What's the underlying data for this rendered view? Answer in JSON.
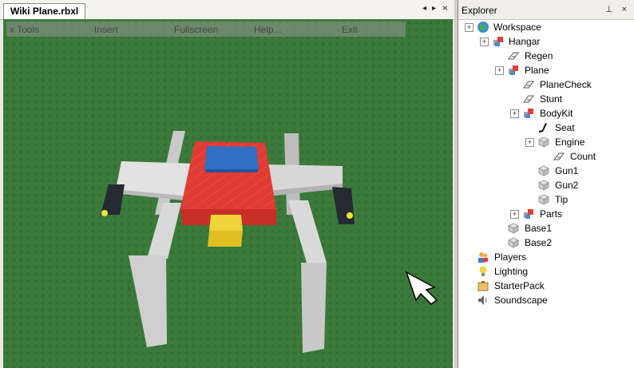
{
  "document": {
    "tab_title": "Wiki Plane.rbxl",
    "pane_controls": [
      "◂",
      "▸",
      "×"
    ]
  },
  "menu": {
    "items": [
      "x Tools",
      "Insert",
      "Fullscreen",
      "Help...",
      "Exit"
    ]
  },
  "explorer": {
    "title": "Explorer",
    "controls": "⊥ ×",
    "tree": [
      {
        "label": "Workspace",
        "icon": "globe-icon",
        "expander": "+"
      },
      {
        "label": "Hangar",
        "icon": "model-icon",
        "expander": "+"
      },
      {
        "label": "Regen",
        "icon": "script-icon",
        "expander": ""
      },
      {
        "label": "Plane",
        "icon": "model-icon",
        "expander": "+"
      },
      {
        "label": "PlaneCheck",
        "icon": "script-icon",
        "expander": ""
      },
      {
        "label": "Stunt",
        "icon": "script-icon",
        "expander": ""
      },
      {
        "label": "BodyKit",
        "icon": "model-icon",
        "expander": "+"
      },
      {
        "label": "Seat",
        "icon": "seat-icon",
        "expander": ""
      },
      {
        "label": "Engine",
        "icon": "brick-icon",
        "expander": "+"
      },
      {
        "label": "Count",
        "icon": "script-icon",
        "expander": ""
      },
      {
        "label": "Gun1",
        "icon": "brick-icon",
        "expander": ""
      },
      {
        "label": "Gun2",
        "icon": "brick-icon",
        "expander": ""
      },
      {
        "label": "Tip",
        "icon": "brick-icon",
        "expander": ""
      },
      {
        "label": "Parts",
        "icon": "model-icon",
        "expander": "+"
      },
      {
        "label": "Base1",
        "icon": "brick-icon",
        "expander": ""
      },
      {
        "label": "Base2",
        "icon": "brick-icon",
        "expander": ""
      },
      {
        "label": "Players",
        "icon": "players-icon",
        "expander": ""
      },
      {
        "label": "Lighting",
        "icon": "lighting-icon",
        "expander": ""
      },
      {
        "label": "StarterPack",
        "icon": "starterpack-icon",
        "expander": ""
      },
      {
        "label": "Soundscape",
        "icon": "speaker-icon",
        "expander": ""
      }
    ]
  },
  "colors": {
    "baseplate": "#3b7a3b",
    "plane_body": "#e03b33",
    "seat": "#2f6fc4",
    "engine": "#e8c933",
    "wings": "#d2d2d2",
    "guns": "#252a33"
  }
}
